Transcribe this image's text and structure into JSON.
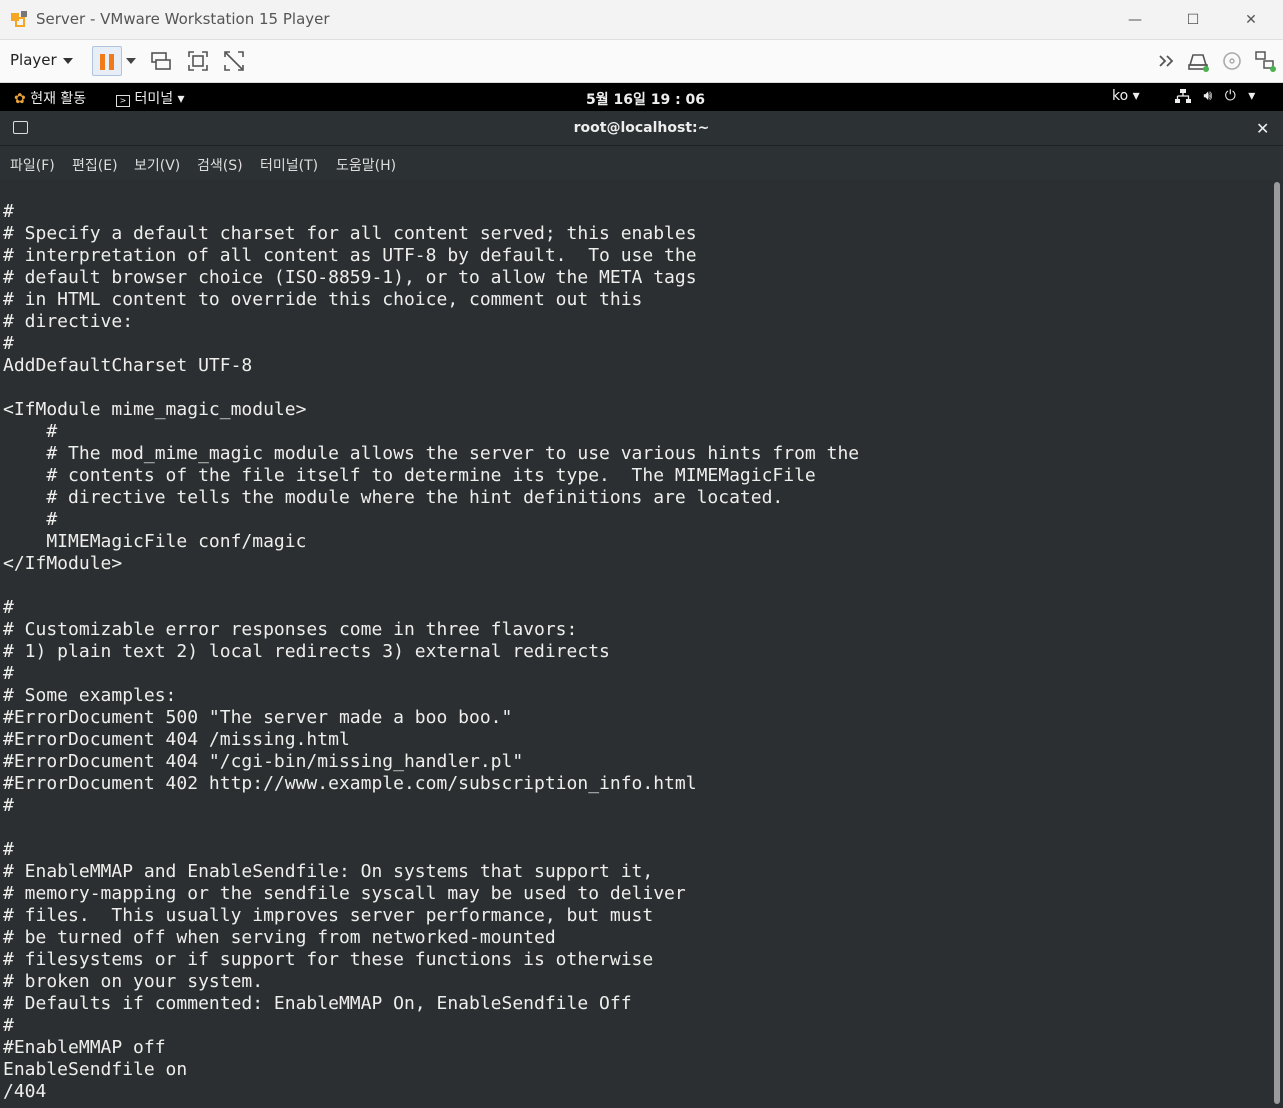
{
  "window": {
    "title": "Server - VMware Workstation 15 Player",
    "minimize_glyph": "—",
    "maximize_glyph": "☐",
    "close_glyph": "✕"
  },
  "toolbar": {
    "player_label": "Player",
    "icons": [
      "pause-icon",
      "send-ctrl-alt-del-icon",
      "full-screen-icon",
      "unity-icon",
      "more-icon",
      "hard-disk-icon",
      "cd-icon",
      "network-icon"
    ]
  },
  "gnome": {
    "activities": "현재 활동",
    "app_menu": "터미널",
    "clock": "5월 16일  19 : 06",
    "language": "ko"
  },
  "terminal": {
    "title": "root@localhost:~",
    "menus": [
      "파일(F)",
      "편집(E)",
      "보기(V)",
      "검색(S)",
      "터미널(T)",
      "도움말(H)"
    ],
    "lines": [
      "#",
      "# Specify a default charset for all content served; this enables",
      "# interpretation of all content as UTF-8 by default.  To use the",
      "# default browser choice (ISO-8859-1), or to allow the META tags",
      "# in HTML content to override this choice, comment out this",
      "# directive:",
      "#",
      "AddDefaultCharset UTF-8",
      "",
      "<IfModule mime_magic_module>",
      "    #",
      "    # The mod_mime_magic module allows the server to use various hints from the",
      "    # contents of the file itself to determine its type.  The MIMEMagicFile",
      "    # directive tells the module where the hint definitions are located.",
      "    #",
      "    MIMEMagicFile conf/magic",
      "</IfModule>",
      "",
      "#",
      "# Customizable error responses come in three flavors:",
      "# 1) plain text 2) local redirects 3) external redirects",
      "#",
      "# Some examples:",
      "#ErrorDocument 500 \"The server made a boo boo.\"",
      "#ErrorDocument 404 /missing.html",
      "#ErrorDocument 404 \"/cgi-bin/missing_handler.pl\"",
      "#ErrorDocument 402 http://www.example.com/subscription_info.html",
      "#",
      "",
      "#",
      "# EnableMMAP and EnableSendfile: On systems that support it,",
      "# memory-mapping or the sendfile syscall may be used to deliver",
      "# files.  This usually improves server performance, but must",
      "# be turned off when serving from networked-mounted",
      "# filesystems or if support for these functions is otherwise",
      "# broken on your system.",
      "# Defaults if commented: EnableMMAP On, EnableSendfile Off",
      "#",
      "#EnableMMAP off",
      "EnableSendfile on",
      "/404"
    ]
  }
}
